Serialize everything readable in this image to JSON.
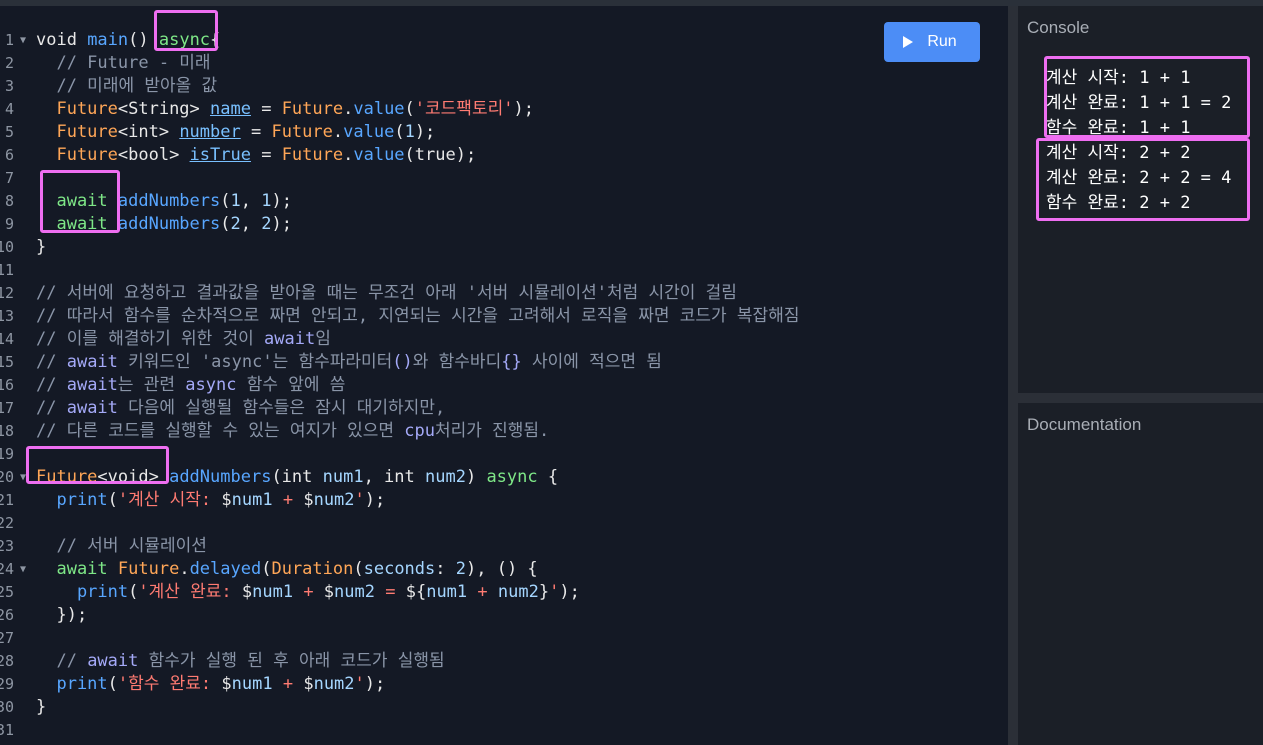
{
  "toolbar": {
    "run_label": "Run"
  },
  "console": {
    "title": "Console",
    "lines": [
      "계산 시작: 1 + 1",
      "계산 완료: 1 + 1 = 2",
      "함수 완료: 1 + 1",
      "계산 시작: 2 + 2",
      "계산 완료: 2 + 2 = 4",
      "함수 완료: 2 + 2"
    ]
  },
  "documentation": {
    "title": "Documentation"
  },
  "editor": {
    "line_numbers": [
      "1",
      "2",
      "3",
      "4",
      "5",
      "6",
      "7",
      "8",
      "9",
      "10",
      "11",
      "12",
      "13",
      "14",
      "15",
      "16",
      "17",
      "18",
      "19",
      "20",
      "21",
      "22",
      "23",
      "24",
      "25",
      "26",
      "27",
      "28",
      "29",
      "30",
      "31"
    ],
    "lines": [
      [
        [
          "kw",
          "void "
        ],
        [
          "fn",
          "main"
        ],
        [
          "kw",
          "() "
        ],
        [
          "aw",
          "async"
        ],
        [
          "kw",
          "{"
        ]
      ],
      [
        [
          "cm",
          "  // Future - 미래"
        ]
      ],
      [
        [
          "cm",
          "  // 미래에 받아올 값"
        ]
      ],
      [
        [
          "ty",
          "  Future"
        ],
        [
          "kw",
          "<String> "
        ],
        [
          "var",
          "name"
        ],
        [
          "kw",
          " = "
        ],
        [
          "ty",
          "Future"
        ],
        [
          "kw",
          "."
        ],
        [
          "fn",
          "value"
        ],
        [
          "kw",
          "("
        ],
        [
          "str",
          "'코드팩토리'"
        ],
        [
          "kw",
          ");"
        ]
      ],
      [
        [
          "ty",
          "  Future"
        ],
        [
          "kw",
          "<int> "
        ],
        [
          "var",
          "number"
        ],
        [
          "kw",
          " = "
        ],
        [
          "ty",
          "Future"
        ],
        [
          "kw",
          "."
        ],
        [
          "fn",
          "value"
        ],
        [
          "kw",
          "("
        ],
        [
          "num",
          "1"
        ],
        [
          "kw",
          ");"
        ]
      ],
      [
        [
          "ty",
          "  Future"
        ],
        [
          "kw",
          "<bool> "
        ],
        [
          "var",
          "isTrue"
        ],
        [
          "kw",
          " = "
        ],
        [
          "ty",
          "Future"
        ],
        [
          "kw",
          "."
        ],
        [
          "fn",
          "value"
        ],
        [
          "kw",
          "("
        ],
        [
          "kw",
          "true"
        ],
        [
          "kw",
          ");"
        ]
      ],
      [],
      [
        [
          "aw",
          "  await "
        ],
        [
          "fn",
          "addNumbers"
        ],
        [
          "kw",
          "("
        ],
        [
          "num",
          "1"
        ],
        [
          "kw",
          ", "
        ],
        [
          "num",
          "1"
        ],
        [
          "kw",
          ");"
        ]
      ],
      [
        [
          "aw",
          "  await "
        ],
        [
          "fn",
          "addNumbers"
        ],
        [
          "kw",
          "("
        ],
        [
          "num",
          "2"
        ],
        [
          "kw",
          ", "
        ],
        [
          "num",
          "2"
        ],
        [
          "kw",
          ");"
        ]
      ],
      [
        [
          "kw",
          "}"
        ]
      ],
      [],
      [
        [
          "cm",
          "// 서버에 요청하고 결과값을 받아올 때는 무조건 아래 '서버 시뮬레이션'처럼 시간이 걸림"
        ]
      ],
      [
        [
          "cm",
          "// 따라서 함수를 순차적으로 짜면 안되고, 지연되는 시간을 고려해서 로직을 짜면 코드가 복잡해짐"
        ]
      ],
      [
        [
          "cm",
          "// 이를 해결하기 위한 것이 "
        ],
        [
          "cmkw",
          "await"
        ],
        [
          "cm",
          "임"
        ]
      ],
      [
        [
          "cm",
          "// "
        ],
        [
          "cmkw",
          "await"
        ],
        [
          "cm",
          " 키워드인 'async'는 함수파라미터"
        ],
        [
          "cmkw",
          "()"
        ],
        [
          "cm",
          "와 함수바디"
        ],
        [
          "cmkw",
          "{}"
        ],
        [
          "cm",
          " 사이에 적으면 됨"
        ]
      ],
      [
        [
          "cm",
          "// "
        ],
        [
          "cmkw",
          "await"
        ],
        [
          "cm",
          "는 관련 "
        ],
        [
          "cmkw",
          "async"
        ],
        [
          "cm",
          " 함수 앞에 씀"
        ]
      ],
      [
        [
          "cm",
          "// "
        ],
        [
          "cmkw",
          "await"
        ],
        [
          "cm",
          " 다음에 실행될 함수들은 잠시 대기하지만,"
        ]
      ],
      [
        [
          "cm",
          "// 다른 코드를 실행할 수 있는 여지가 있으면 "
        ],
        [
          "cmkw",
          "cpu"
        ],
        [
          "cm",
          "처리가 진행됨."
        ]
      ],
      [],
      [
        [
          "ty",
          "Future"
        ],
        [
          "kw",
          "<void> "
        ],
        [
          "fn",
          "addNumbers"
        ],
        [
          "kw",
          "(int "
        ],
        [
          "num",
          "num1"
        ],
        [
          "kw",
          ", int "
        ],
        [
          "num",
          "num2"
        ],
        [
          "kw",
          ") "
        ],
        [
          "aw",
          "async"
        ],
        [
          "kw",
          " {"
        ]
      ],
      [
        [
          "fn",
          "  print"
        ],
        [
          "kw",
          "("
        ],
        [
          "str",
          "'계산 시작: "
        ],
        [
          "kw",
          "$"
        ],
        [
          "num",
          "num1"
        ],
        [
          "str",
          " + "
        ],
        [
          "kw",
          "$"
        ],
        [
          "num",
          "num2"
        ],
        [
          "str",
          "'"
        ],
        [
          "kw",
          ");"
        ]
      ],
      [],
      [
        [
          "cm",
          "  // 서버 시뮬레이션"
        ]
      ],
      [
        [
          "aw",
          "  await "
        ],
        [
          "ty",
          "Future"
        ],
        [
          "kw",
          "."
        ],
        [
          "fn",
          "delayed"
        ],
        [
          "kw",
          "("
        ],
        [
          "ty",
          "Duration"
        ],
        [
          "kw",
          "("
        ],
        [
          "num",
          "seconds"
        ],
        [
          "kw",
          ": "
        ],
        [
          "num",
          "2"
        ],
        [
          "kw",
          "), () {"
        ]
      ],
      [
        [
          "fn",
          "    print"
        ],
        [
          "kw",
          "("
        ],
        [
          "str",
          "'계산 완료: "
        ],
        [
          "kw",
          "$"
        ],
        [
          "num",
          "num1"
        ],
        [
          "str",
          " + "
        ],
        [
          "kw",
          "$"
        ],
        [
          "num",
          "num2"
        ],
        [
          "str",
          " = "
        ],
        [
          "kw",
          "${"
        ],
        [
          "num",
          "num1"
        ],
        [
          "str",
          " + "
        ],
        [
          "num",
          "num2"
        ],
        [
          "kw",
          "}"
        ],
        [
          "str",
          "'"
        ],
        [
          "kw",
          ");"
        ]
      ],
      [
        [
          "kw",
          "  });"
        ]
      ],
      [],
      [
        [
          "cm",
          "  // "
        ],
        [
          "cmkw",
          "await"
        ],
        [
          "cm",
          " 함수가 실행 된 후 아래 코드가 실행됨"
        ]
      ],
      [
        [
          "fn",
          "  print"
        ],
        [
          "kw",
          "("
        ],
        [
          "str",
          "'함수 완료: "
        ],
        [
          "kw",
          "$"
        ],
        [
          "num",
          "num1"
        ],
        [
          "str",
          " + "
        ],
        [
          "kw",
          "$"
        ],
        [
          "num",
          "num2"
        ],
        [
          "str",
          "'"
        ],
        [
          "kw",
          ");"
        ]
      ],
      [
        [
          "kw",
          "}"
        ]
      ],
      []
    ]
  }
}
